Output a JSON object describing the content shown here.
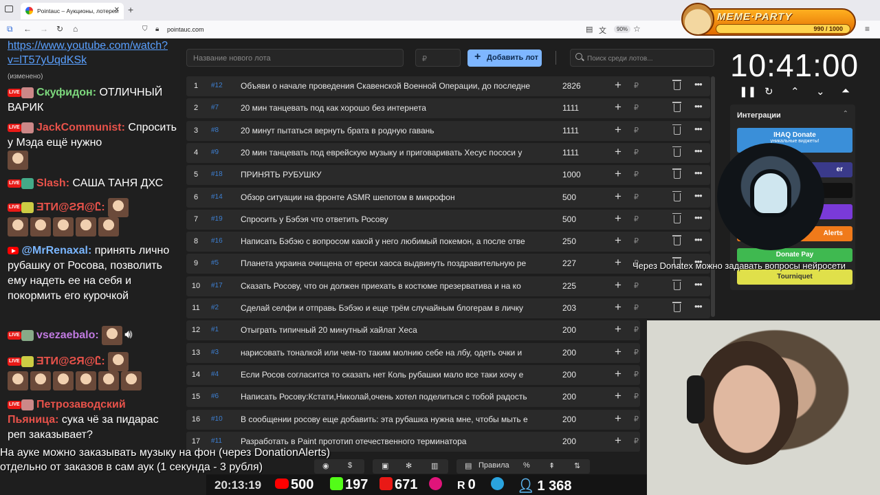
{
  "browser": {
    "tab_title": "Pointauc – Аукционы, лотереи",
    "url": "pointauc.com",
    "zoom": "90%"
  },
  "meme_party": {
    "title": "MEME·PARTY",
    "progress": "990 / 1000"
  },
  "chat": {
    "link": "https://www.youtube.com/watch?v=lT57yUqdKSk",
    "removed_note": "(изменено)",
    "messages": [
      {
        "user": "Скуфидон:",
        "text": "ОТЛИЧНЫЙ ВАРИК",
        "color": "#7dd87d"
      },
      {
        "user": "JackCommunist:",
        "text": "Спросить у Мэда ещё нужно",
        "color": "#e8524a"
      },
      {
        "user": "Slash:",
        "text": "САША ТАНЯ ДХС",
        "color": "#e8524a"
      },
      {
        "user": "ƎTИ@ƧЯ@Ꮭ:",
        "text": "",
        "color": "#e8524a"
      },
      {
        "user": "@MrRenaxal:",
        "text": "принять лично рубашку от Росова, позволить ему надеть ее на себя и покормить его курочкой",
        "color": "#7ab6ff"
      },
      {
        "user": "vsezaebalo:",
        "text": "",
        "color": "#c07ae0"
      },
      {
        "user": "ƎTИ@ƧЯ@Ꮭ:",
        "text": "",
        "color": "#e8524a"
      },
      {
        "user": "Петрозаводский Пьяница:",
        "text": "сука чё за пидарас реп заказывает?",
        "color": "#e8524a"
      }
    ]
  },
  "main": {
    "lot_placeholder": "Название нового лота",
    "price_placeholder": "₽",
    "add_button": "Добавить лот",
    "search_placeholder": "Поиск среди лотов...",
    "lots": [
      {
        "idx": "1",
        "fid": "#12",
        "name": "Объяви о начале проведения Скавенской Военной Операции, до последне",
        "amount": "2826"
      },
      {
        "idx": "2",
        "fid": "#7",
        "name": "20 мин танцевать под как хорошо без интернета",
        "amount": "1111"
      },
      {
        "idx": "3",
        "fid": "#8",
        "name": "20 минут пытаться вернуть брата в родную гавань",
        "amount": "1111"
      },
      {
        "idx": "4",
        "fid": "#9",
        "name": "20 мин танцевать под еврейскую музыку и приговаривать Хесус пососи у",
        "amount": "1111"
      },
      {
        "idx": "5",
        "fid": "#18",
        "name": "ПРИНЯТЬ РУБУШКУ",
        "amount": "1000"
      },
      {
        "idx": "6",
        "fid": "#14",
        "name": "Обзор ситуации на фронте ASMR шепотом в микрофон",
        "amount": "500"
      },
      {
        "idx": "7",
        "fid": "#19",
        "name": "Спросить у Бэбэя что ответить Росову",
        "amount": "500"
      },
      {
        "idx": "8",
        "fid": "#16",
        "name": "Написать Бэбэю с вопросом какой у него любимый покемон, а после отве",
        "amount": "250"
      },
      {
        "idx": "9",
        "fid": "#5",
        "name": "Планета украина очищена от ереси хаоса выдвинуть поздравительную ре",
        "amount": "227"
      },
      {
        "idx": "10",
        "fid": "#17",
        "name": "Сказать Росову, что он должен приехать в костюме презерватива и на ко",
        "amount": "225"
      },
      {
        "idx": "11",
        "fid": "#2",
        "name": "Сделай селфи и отправь Бэбэю и еще трём случайным блогерам в личку",
        "amount": "203"
      },
      {
        "idx": "12",
        "fid": "#1",
        "name": "Отыграть типичный 20 минутный хайлат Хеса",
        "amount": "200"
      },
      {
        "idx": "13",
        "fid": "#3",
        "name": "нарисовать тоналкой или чем-то таким молнию себе на лбу, одеть очки и",
        "amount": "200"
      },
      {
        "idx": "14",
        "fid": "#4",
        "name": "Если Росов согласится то сказать нет Коль рубашки мало все таки хочу е",
        "amount": "200"
      },
      {
        "idx": "15",
        "fid": "#6",
        "name": "Написать Росову:Кстати,Николай,очень хотел поделиться с тобой радость",
        "amount": "200"
      },
      {
        "idx": "16",
        "fid": "#10",
        "name": "В сообщении росову еще добавить: эта рубашка нужна мне, чтобы мыть е",
        "amount": "200"
      },
      {
        "idx": "17",
        "fid": "#11",
        "name": "Разработать в Paint прототип отечественного терминатора",
        "amount": "200"
      }
    ],
    "currency": "₽"
  },
  "timer": {
    "time": "10:41:00"
  },
  "integrations": {
    "title": "Интеграции",
    "buttons": [
      {
        "label": "IHAQ Donate",
        "sub": "уникальные виджеты!",
        "color": "#3a8fd9"
      },
      {
        "label": "er",
        "sub": "",
        "color": "#3a3a8a"
      },
      {
        "label": "",
        "sub": "",
        "color": "#111111"
      },
      {
        "label": "",
        "sub": "",
        "color": "#7a3ad9"
      },
      {
        "label": "Alerts",
        "sub": "",
        "color": "#f07a1a"
      },
      {
        "label": "Donate Pay",
        "sub": "",
        "color": "#3fb950"
      },
      {
        "label": "Tourniquet",
        "sub": "",
        "color": "#e0e04a"
      }
    ]
  },
  "overlay": {
    "donatex_note": "Через Donatex можно задавать вопросы нейросети",
    "bottom_note_1": "На ауке можно заказывать музыку на фон (через DonationAlerts)",
    "bottom_note_2": "отдельно от заказов в сам аук (1 секунда - 3 рубля)",
    "rules_label": "Правила"
  },
  "stats": {
    "clock": "20:13:19",
    "youtube": "500",
    "kick": "197",
    "vk": "671",
    "rutube": "0",
    "viewers": "1 368"
  }
}
